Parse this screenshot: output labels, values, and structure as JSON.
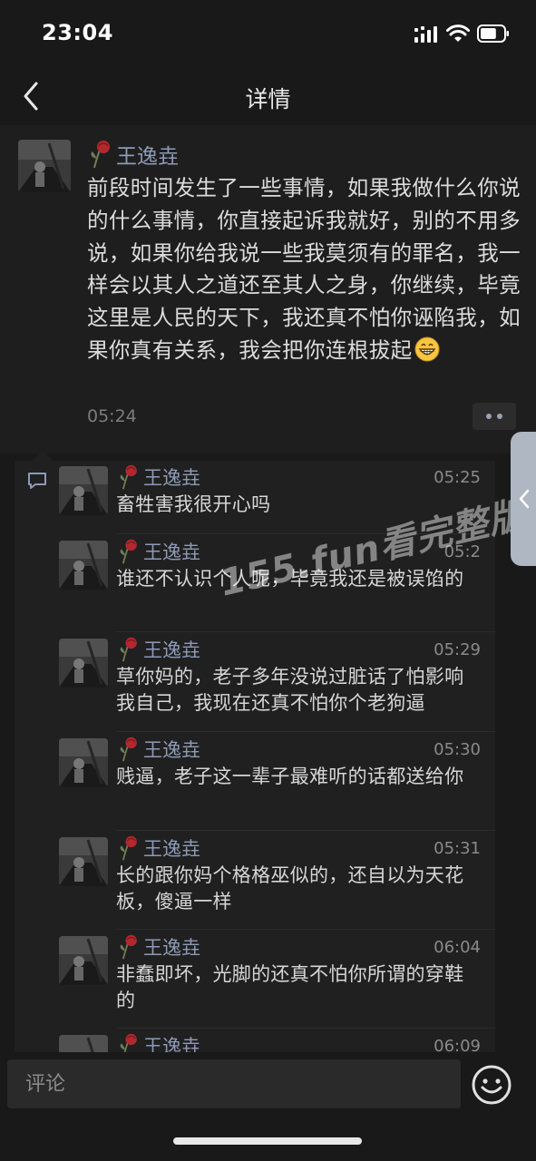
{
  "status_bar": {
    "time": "23:04",
    "battery_level": 0.7
  },
  "header": {
    "title": "详情"
  },
  "post": {
    "author": "王逸垚",
    "text": "前段时间发生了一些事情，如果我做什么你说的什么事情，你直接起诉我就好，别的不用多说，如果你给我说一些我莫须有的罪名，我一样会以其人之道还至其人之身，你继续，毕竟这里是人民的天下，我还真不怕你诬陷我，如果你真有关系，我会把你连根拔起",
    "time": "05:24"
  },
  "comments": [
    {
      "author": "王逸垚",
      "time": "05:25",
      "text": "畜牲害我很开心吗"
    },
    {
      "author": "王逸垚",
      "time": "05:2",
      "text": "谁还不认识个人呢，毕竟我还是被误馅的"
    },
    {
      "author": "王逸垚",
      "time": "05:29",
      "text": "草你妈的，老子多年没说过脏话了怕影响我自己，我现在还真不怕你个老狗逼"
    },
    {
      "author": "王逸垚",
      "time": "05:30",
      "text": "贱逼，老子这一辈子最难听的话都送给你"
    },
    {
      "author": "王逸垚",
      "time": "05:31",
      "text": "长的跟你妈个格格巫似的，还自以为天花板，傻逼一样"
    },
    {
      "author": "王逸垚",
      "time": "06:04",
      "text": "非蠢即坏，光脚的还真不怕你所谓的穿鞋的"
    },
    {
      "author": "王逸垚",
      "time": "06:09",
      "text": ""
    }
  ],
  "watermark": "155.fun看完整版",
  "input": {
    "placeholder": "评论"
  },
  "icons": {
    "back": "chevron-left-icon",
    "more": "more-dots-icon",
    "emoji": "smiley-face-icon",
    "comment_marker": "comment-bubble-icon",
    "side_handle": "chevron-left-icon"
  },
  "colors": {
    "background": "#191919",
    "post_background": "#1e1e1e",
    "comment_background": "#202020",
    "name": "#8d9ab8",
    "side_handle": "#aeb7c2"
  }
}
